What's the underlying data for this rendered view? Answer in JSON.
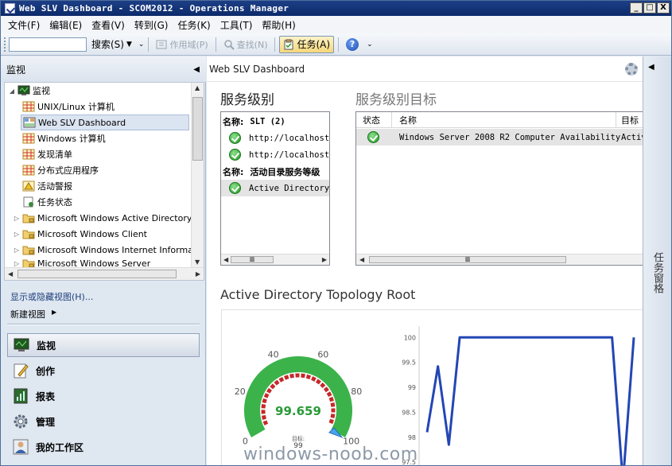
{
  "window": {
    "title": "Web SLV Dashboard - SCOM2012 - Operations Manager",
    "buttons": [
      "_",
      "□",
      "X"
    ]
  },
  "menu": [
    "文件(F)",
    "编辑(E)",
    "查看(V)",
    "转到(G)",
    "任务(K)",
    "工具(T)",
    "帮助(H)"
  ],
  "toolbar": {
    "search_value": "",
    "search_label": "搜索(S)",
    "scope_label": "作用域(P)",
    "find_label": "查找(N)",
    "tasks_label": "任务(A)",
    "help_label": "?"
  },
  "left_pane": {
    "header": "监视",
    "tree": [
      {
        "label": "监视",
        "level": 0,
        "expanded": true
      },
      {
        "label": "UNIX/Linux 计算机",
        "level": 1
      },
      {
        "label": "Web SLV Dashboard",
        "level": 1,
        "selected": true
      },
      {
        "label": "Windows 计算机",
        "level": 1
      },
      {
        "label": "发现清单",
        "level": 1
      },
      {
        "label": "分布式应用程序",
        "level": 1
      },
      {
        "label": "活动警报",
        "level": 1
      },
      {
        "label": "任务状态",
        "level": 1
      },
      {
        "label": "Microsoft Windows Active Directory",
        "level": 1,
        "folder": true
      },
      {
        "label": "Microsoft Windows Client",
        "level": 1,
        "folder": true
      },
      {
        "label": "Microsoft Windows Internet Informatio",
        "level": 1,
        "folder": true
      },
      {
        "label": "Microsoft Windows Server",
        "level": 1,
        "folder": true
      }
    ],
    "show_hide_views": "显示或隐藏视图(H)...",
    "new_view": "新建视图",
    "nav_buttons": [
      "监视",
      "创作",
      "报表",
      "管理",
      "我的工作区"
    ]
  },
  "main": {
    "header": "Web SLV Dashboard",
    "sla_title": "服务级别",
    "sla_groups": [
      {
        "heading": "名称:",
        "name": "SLT  (2)",
        "items": [
          "http://localhost",
          "http://localhost"
        ]
      },
      {
        "heading": "名称:",
        "name": "活动目录服务等级",
        "items": [
          "Active Directory"
        ]
      }
    ],
    "slo_title": "服务级别目标",
    "slo_columns": [
      "状态",
      "名称",
      "目标"
    ],
    "slo_rows": [
      {
        "name": "Windows Server 2008 R2 Computer Availability",
        "target": "Activ"
      }
    ],
    "topology_title": "Active Directory Topology Root",
    "scroll_thumb": "▥"
  },
  "gauge": {
    "value": "99.659",
    "target_label": "目标:",
    "target_value": "99",
    "ticks": [
      "0",
      "20",
      "40",
      "60",
      "80",
      "100"
    ]
  },
  "chart_data": {
    "type": "line",
    "title": "",
    "y_ticks": [
      "100",
      "99.5",
      "99",
      "98.5",
      "98",
      "97.5"
    ],
    "ylim": [
      97.2,
      100.1
    ],
    "values": [
      98.1,
      99.42,
      97.85,
      100,
      100,
      100,
      100,
      100,
      100,
      100,
      100,
      100,
      100,
      100,
      100,
      100,
      100,
      100,
      97.1,
      100
    ],
    "color": "#2346b5"
  },
  "task_pane": {
    "label": "任务窗格"
  },
  "watermark": "windows-noob.com"
}
